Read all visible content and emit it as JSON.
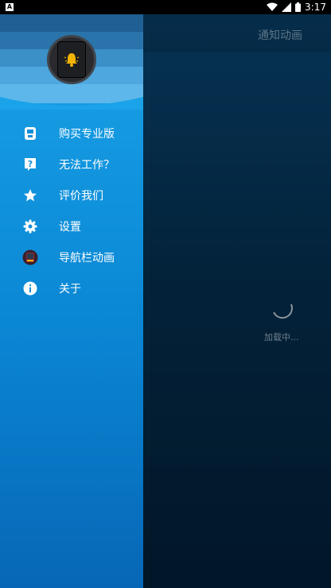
{
  "status_bar": {
    "time": "3:17",
    "notification_letter": "A"
  },
  "main": {
    "title": "通知动画",
    "loading_text": "加载中..."
  },
  "drawer": {
    "items": [
      {
        "label": "购买专业版",
        "icon": "shop-icon"
      },
      {
        "label": "无法工作？",
        "icon": "help-icon"
      },
      {
        "label": "评价我们",
        "icon": "star-icon"
      },
      {
        "label": "设置",
        "icon": "gear-icon"
      },
      {
        "label": "导航栏动画",
        "icon": "nav-animation-icon"
      },
      {
        "label": "关于",
        "icon": "info-icon"
      }
    ]
  },
  "colors": {
    "drawer_top": "#1aa3e8",
    "drawer_bottom": "#0767b6",
    "main_bg": "#06365a",
    "accent_bell": "#f4b400"
  }
}
